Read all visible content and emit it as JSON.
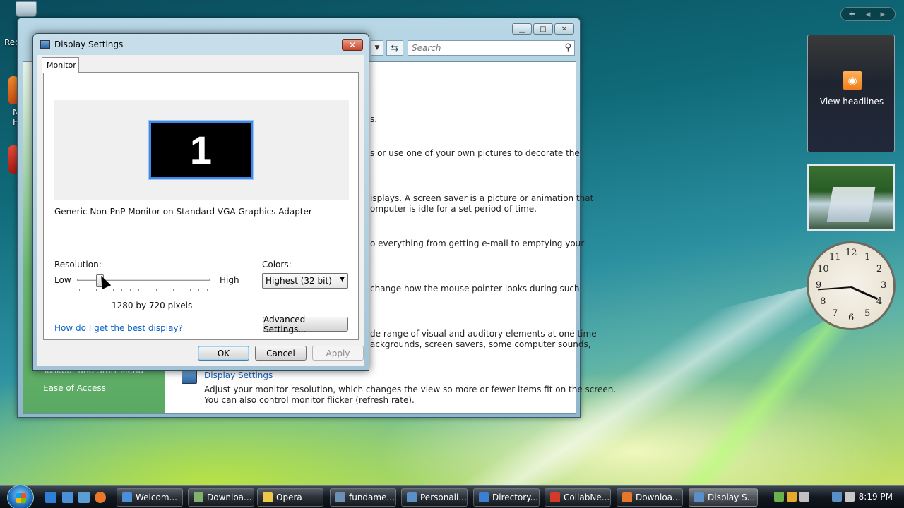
{
  "desktop": {
    "recycle_label": "Rec",
    "icon_labels": [
      "N",
      "F"
    ]
  },
  "control_panel": {
    "search_placeholder": "Search",
    "sidebar_items": [
      "Taskbar and Start Menu",
      "Ease of Access"
    ],
    "text_lines": [
      "s.",
      "s or use one of your own pictures to decorate the",
      "isplays. A screen saver is a picture or animation that",
      "omputer is idle for a set period of time.",
      "o everything from getting e-mail to emptying your",
      "change how the mouse pointer looks during such",
      "de range of visual and auditory elements at one time",
      "ackgrounds, screen savers, some computer sounds,"
    ],
    "display_settings_title": "Display Settings",
    "display_settings_desc_1": "Adjust your monitor resolution, which changes the view so more or fewer items fit on the screen.",
    "display_settings_desc_2": "You can also control monitor flicker (refresh rate)."
  },
  "dialog": {
    "title": "Display Settings",
    "tab": "Monitor",
    "monitor_number": "1",
    "monitor_description": "Generic Non-PnP Monitor on Standard VGA Graphics Adapter",
    "resolution_label": "Resolution:",
    "low_label": "Low",
    "high_label": "High",
    "resolution_value": "1280 by 720 pixels",
    "resolution_slider_level": 0.17,
    "colors_label": "Colors:",
    "colors_value": "Highest (32 bit)",
    "help_link": "How do I get the best display?",
    "advanced_button": "Advanced Settings...",
    "ok_button": "OK",
    "cancel_button": "Cancel",
    "apply_button": "Apply"
  },
  "gadgets": {
    "feed_label": "View headlines",
    "clock_numbers": [
      "12",
      "1",
      "2",
      "3",
      "4",
      "5",
      "6",
      "7",
      "8",
      "9",
      "10",
      "11"
    ]
  },
  "taskbar": {
    "items": [
      "Welcom...",
      "Downloa...",
      "Opera",
      "fundame...",
      "Personali...",
      "Directory...",
      "CollabNe...",
      "Downloa...",
      "Display S..."
    ],
    "time": "8:19 PM"
  }
}
